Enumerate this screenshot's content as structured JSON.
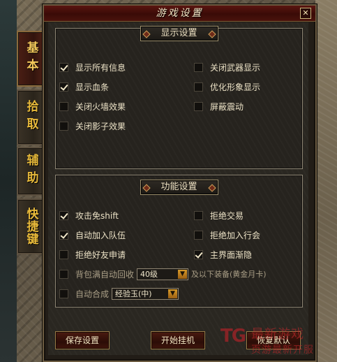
{
  "window": {
    "title": "游戏设置",
    "close_label": "✕"
  },
  "side_tabs": [
    {
      "label": "基本",
      "active": true
    },
    {
      "label": "拾取",
      "active": false
    },
    {
      "label": "辅助",
      "active": false
    },
    {
      "label": "快捷键",
      "active": false
    }
  ],
  "display_section": {
    "header": "显示设置",
    "options": [
      {
        "label": "显示所有信息",
        "checked": true
      },
      {
        "label": "关闭武器显示",
        "checked": false
      },
      {
        "label": "显示血条",
        "checked": true
      },
      {
        "label": "优化形象显示",
        "checked": false
      },
      {
        "label": "关闭火墙效果",
        "checked": false
      },
      {
        "label": "屏蔽震动",
        "checked": false
      },
      {
        "label": "关闭影子效果",
        "checked": false
      }
    ]
  },
  "function_section": {
    "header": "功能设置",
    "options": [
      {
        "label": "攻击免shift",
        "checked": true
      },
      {
        "label": "拒绝交易",
        "checked": false
      },
      {
        "label": "自动加入队伍",
        "checked": true
      },
      {
        "label": "拒绝加入行会",
        "checked": false
      },
      {
        "label": "拒绝好友申请",
        "checked": false
      },
      {
        "label": "主界面渐隐",
        "checked": true
      }
    ],
    "auto_recycle": {
      "label": "背包满自动回收",
      "checked": false,
      "select_value": "40级",
      "suffix": "及以下装备(黄金月卡)"
    },
    "auto_combine": {
      "label": "自动合成",
      "checked": false,
      "select_value": "经验玉(中)"
    }
  },
  "buttons": {
    "save": "保存设置",
    "start_hangup": "开始挂机",
    "restore_default": "恢复默认"
  },
  "watermark": {
    "logo": "TG",
    "line1": "最新游戏",
    "line2": "页游最新开服"
  },
  "icons": {
    "dropdown": "▼",
    "close": "close-icon"
  },
  "colors": {
    "accent_gold": "#e7b93a",
    "title_bar": "#5a1510",
    "button_red": "#4a1a10"
  }
}
